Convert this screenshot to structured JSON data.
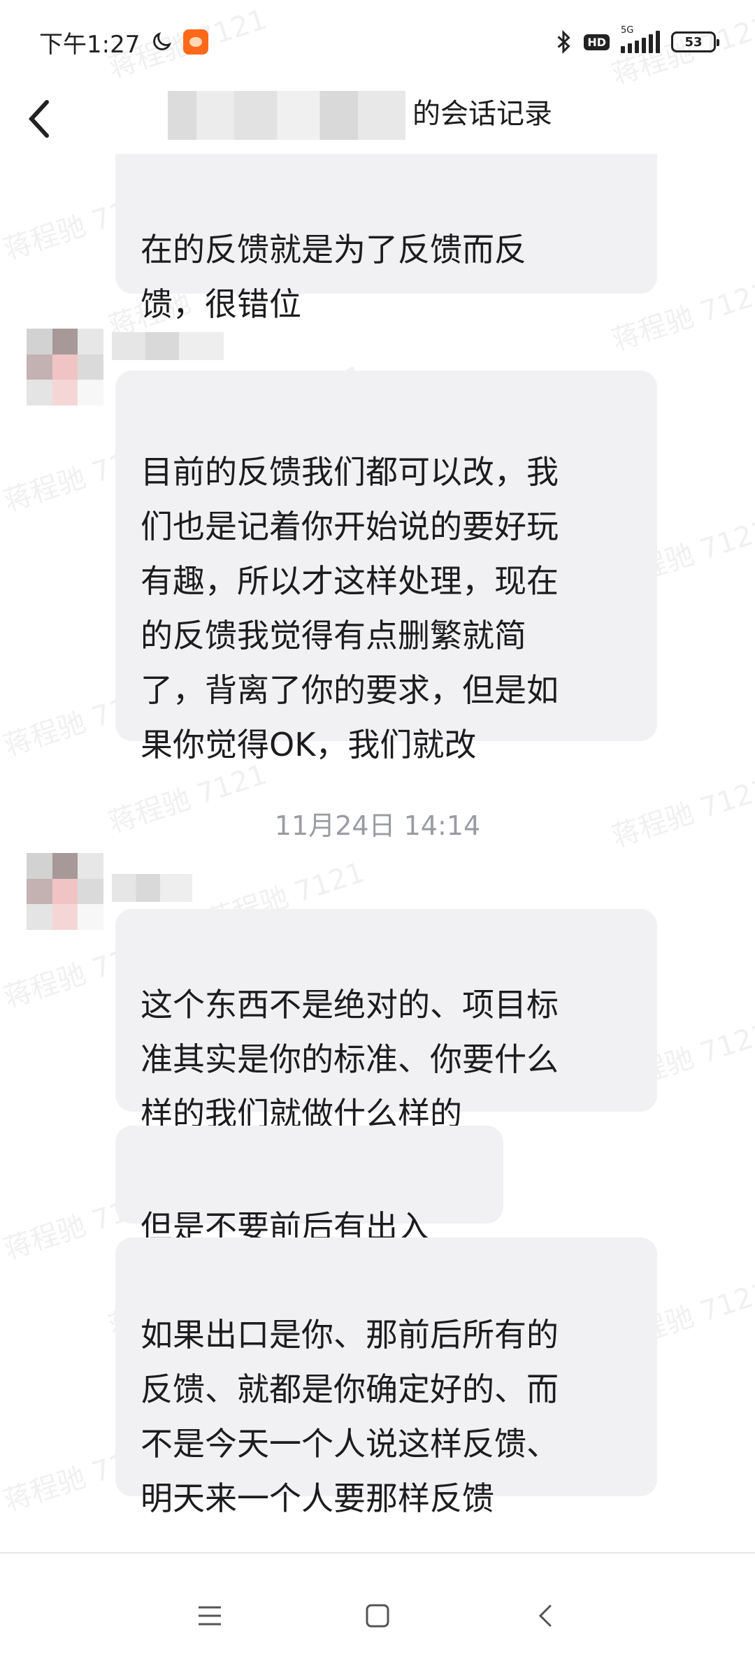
{
  "status_bar": {
    "time": "下午1:27",
    "hd": "HD",
    "network": "5G",
    "battery": "53"
  },
  "header": {
    "title": "的会话记录"
  },
  "messages": [
    {
      "text": "在的反馈就是为了反馈而反\n馈，很错位"
    },
    {
      "text": "目前的反馈我们都可以改，我\n们也是记着你开始说的要好玩\n有趣，所以才这样处理，现在\n的反馈我觉得有点删繁就简\n了，背离了你的要求，但是如\n果你觉得OK，我们就改"
    },
    {
      "text": "这个东西不是绝对的、项目标\n准其实是你的标准、你要什么\n样的我们就做什么样的"
    },
    {
      "text": "但是不要前后有出入"
    },
    {
      "text": "如果出口是你、那前后所有的\n反馈、就都是你确定好的、而\n不是今天一个人说这样反馈、\n明天来一个人要那样反馈"
    }
  ],
  "timestamp": "11月24日 14:14",
  "watermark_text": "蒋程驰 7121",
  "colors": {
    "bubble_bg": "#f1f1f3",
    "timestamp": "#9a9ca3",
    "text": "#1c1c1e"
  }
}
